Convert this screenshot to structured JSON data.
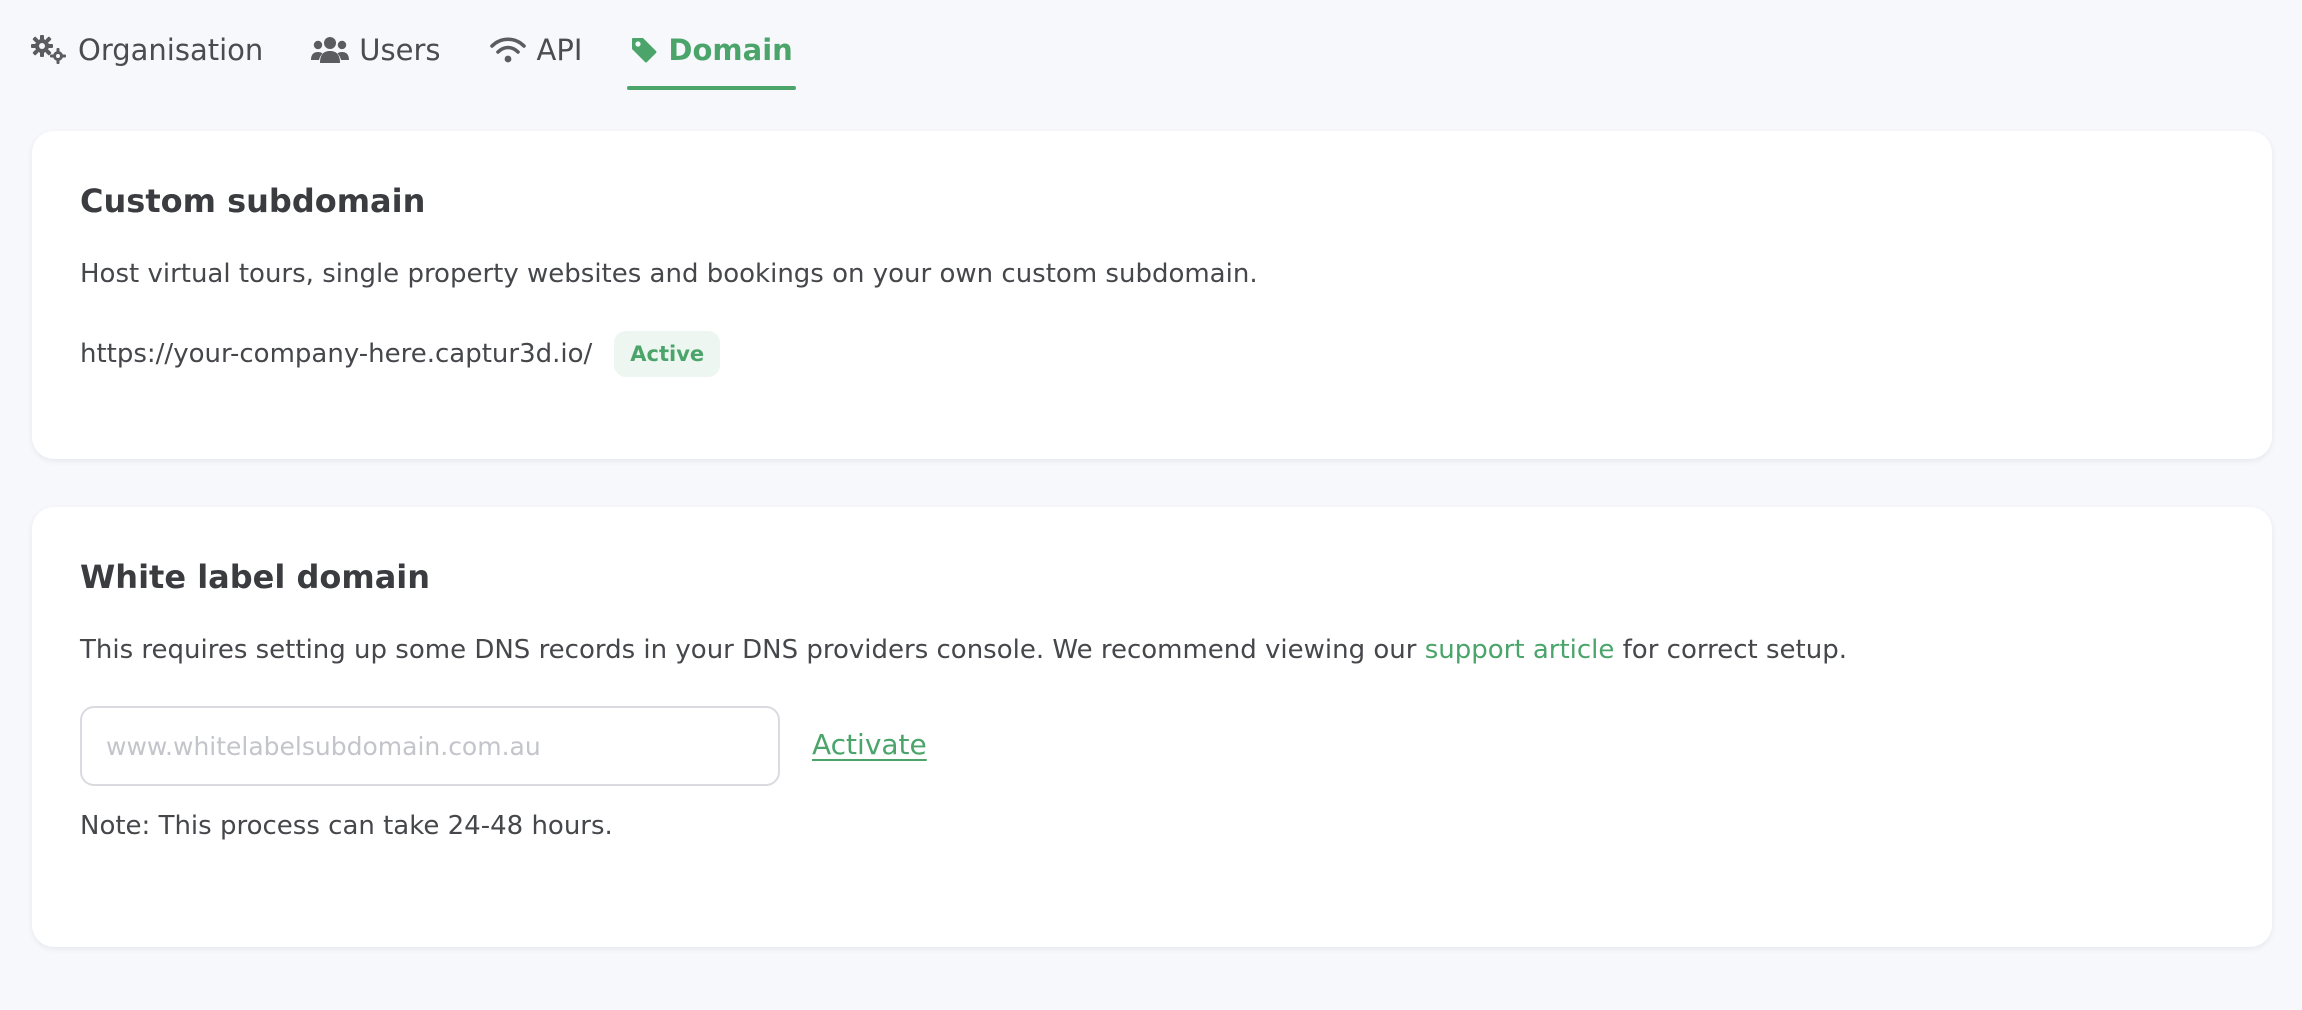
{
  "tabs": [
    {
      "label": "Organisation",
      "icon": "gears-icon",
      "active": false
    },
    {
      "label": "Users",
      "icon": "users-icon",
      "active": false
    },
    {
      "label": "API",
      "icon": "wifi-icon",
      "active": false
    },
    {
      "label": "Domain",
      "icon": "tag-icon",
      "active": true
    }
  ],
  "custom_subdomain": {
    "title": "Custom subdomain",
    "description": "Host virtual tours, single property websites and bookings on your own custom subdomain.",
    "url": "https://your-company-here.captur3d.io/",
    "status": "Active"
  },
  "white_label": {
    "title": "White label domain",
    "description_before": "This requires setting up some DNS records in your DNS providers console. We recommend viewing our ",
    "link_text": "support article",
    "description_after": " for correct setup.",
    "input_value": "",
    "input_placeholder": "www.whitelabelsubdomain.com.au",
    "activate_label": "Activate",
    "note": "Note: This process can take 24-48 hours."
  },
  "colors": {
    "accent": "#4ba56b",
    "badge_bg": "#edf6f0",
    "page_bg": "#f7f8fc",
    "text": "#45474b"
  }
}
